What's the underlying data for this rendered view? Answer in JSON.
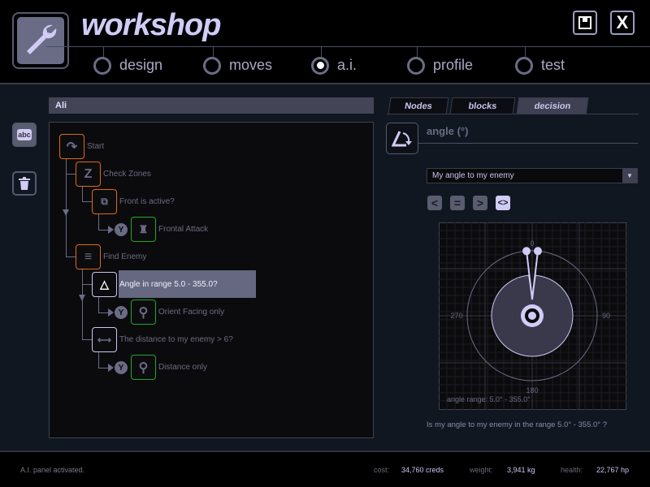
{
  "header": {
    "title": "workshop",
    "save_icon": "floppy-disk-icon",
    "close_label": "X"
  },
  "nav": [
    {
      "label": "design",
      "active": false
    },
    {
      "label": "moves",
      "active": false
    },
    {
      "label": "a.i.",
      "active": true
    },
    {
      "label": "profile",
      "active": false
    },
    {
      "label": "test",
      "active": false
    }
  ],
  "sidebar": {
    "rename_label": "abc",
    "delete_icon": "trash-icon"
  },
  "tree": {
    "title": "Ali",
    "nodes": [
      {
        "label": "Start",
        "icon": "u-turn-icon"
      },
      {
        "label": "Check Zones",
        "icon": "z-icon"
      },
      {
        "label": "Front is active?",
        "icon": "cube-icon"
      },
      {
        "label": "Frontal Attack",
        "icon": "robot-icon",
        "branch": "Y"
      },
      {
        "label": "Find Enemy",
        "icon": "list-icon"
      },
      {
        "label": "Angle in range 5.0 - 355.0?",
        "icon": "angle-icon",
        "selected": true
      },
      {
        "label": "Orient Facing only",
        "icon": "search-icon",
        "branch": "Y"
      },
      {
        "label": "The distance to my enemy > 6?",
        "icon": "distance-icon"
      },
      {
        "label": "Distance only",
        "icon": "search-icon",
        "branch": "Y"
      }
    ]
  },
  "panel": {
    "tabs": [
      {
        "label": "Nodes"
      },
      {
        "label": "blocks"
      },
      {
        "label": "decision",
        "active": true
      }
    ],
    "title": "angle (°)",
    "dropdown_value": "My angle to my enemy",
    "dropdown_arrow": "▼",
    "comparators": [
      {
        "label": "<"
      },
      {
        "label": "="
      },
      {
        "label": ">"
      },
      {
        "label": "<>",
        "active": true
      }
    ],
    "dial": {
      "labels": {
        "top": "0",
        "right": "90",
        "bottom": "180",
        "left": "270"
      },
      "range_min": 5.0,
      "range_max": 355.0,
      "range_text": "angle range: 5.0° - 355.0°"
    },
    "caption": "Is my angle to my enemy in the range 5.0° - 355.0° ?"
  },
  "footer": {
    "status": "A.I. panel activated.",
    "cost_label": "cost:",
    "cost": "34,760 creds",
    "weight_label": "weight:",
    "weight": "3,941 kg",
    "health_label": "health:",
    "health": "22,767 hp"
  },
  "colors": {
    "accent": "#d0ccf6",
    "orange": "#e06a10",
    "green": "#1fa82e"
  }
}
